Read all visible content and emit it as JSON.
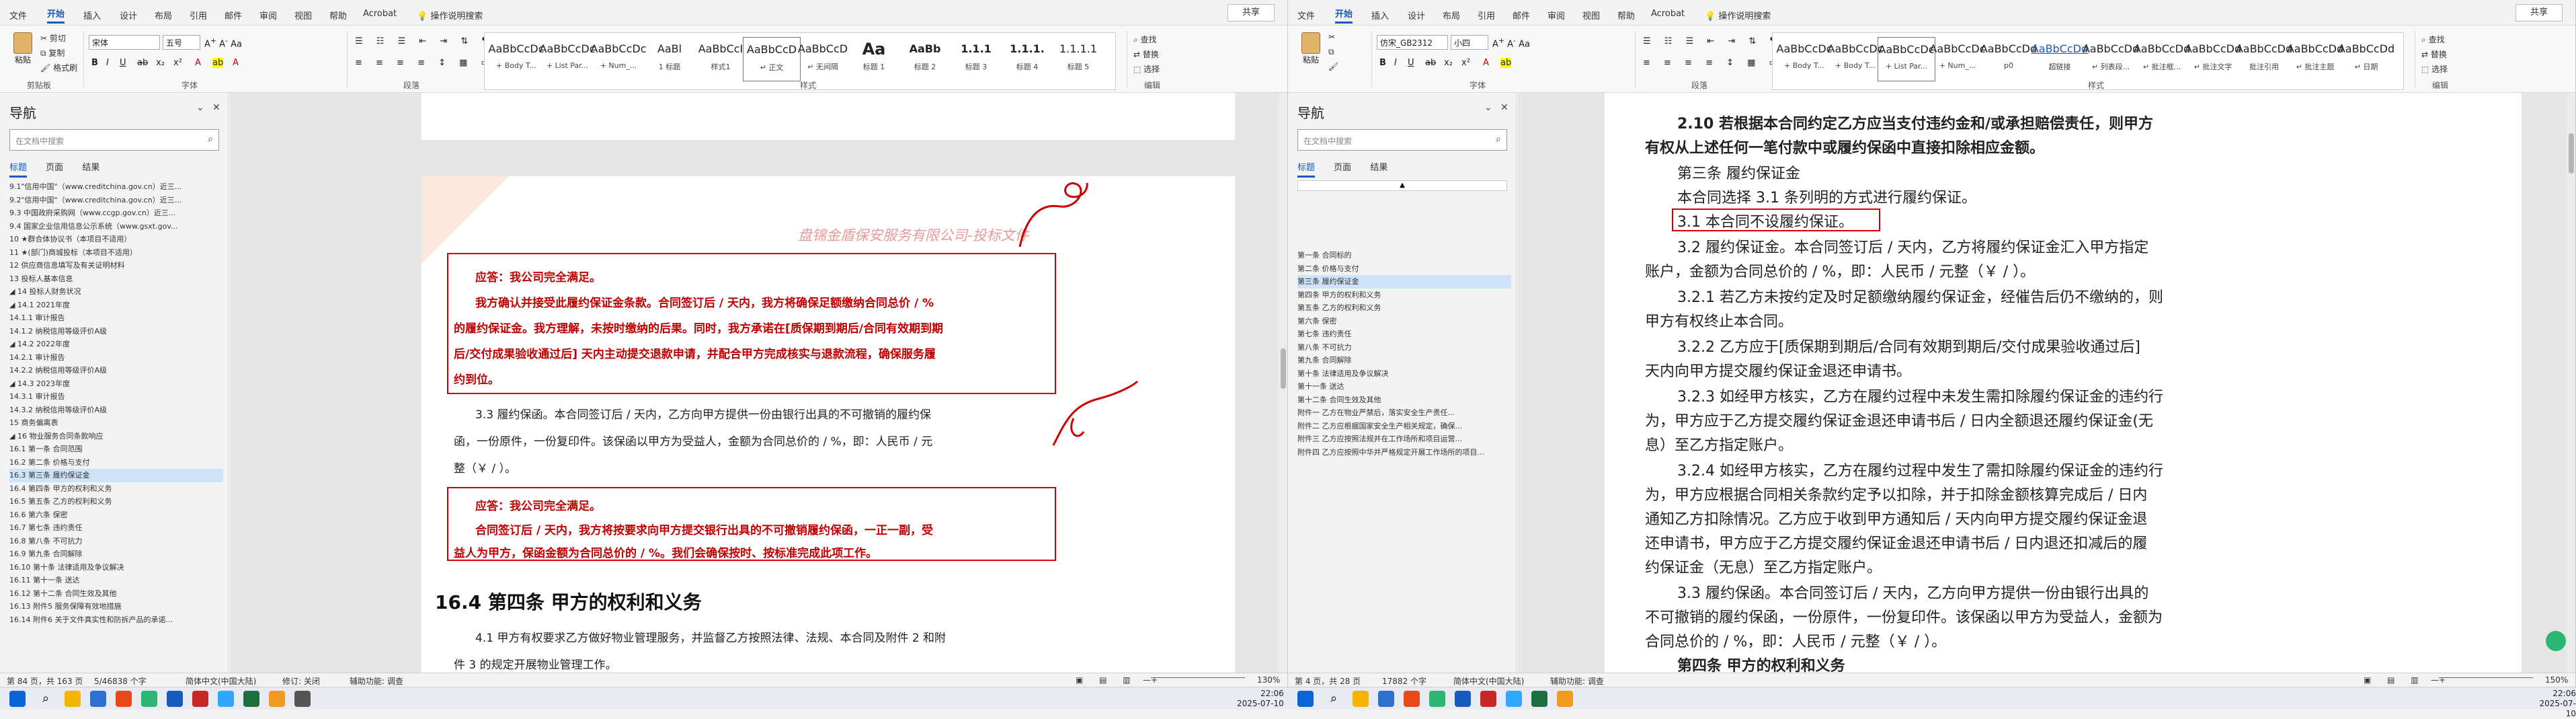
{
  "left_window": {
    "tabs": [
      "文件",
      "开始",
      "插入",
      "设计",
      "布局",
      "引用",
      "邮件",
      "审阅",
      "视图",
      "帮助",
      "Acrobat",
      "操作说明搜索"
    ],
    "share": "共享",
    "clipboard": {
      "paste": "粘贴",
      "cut": "剪切",
      "copy": "复制",
      "format_painter": "格式刷",
      "group": "剪贴板"
    },
    "font": {
      "name": "宋体",
      "size": "五号",
      "group": "字体"
    },
    "paragraph_group": "段落",
    "styles_group": "样式",
    "styles": [
      {
        "preview": "AaBbCcDc",
        "name": "+ Body T..."
      },
      {
        "preview": "AaBbCcDc",
        "name": "+ List Par..."
      },
      {
        "preview": "AaBbCcDc",
        "name": "+ Num_..."
      },
      {
        "preview": "AaBl",
        "name": "1 标题"
      },
      {
        "preview": "AaBbCcI",
        "name": "样式1"
      },
      {
        "preview": "AaBbCcD",
        "name": "↵ 正文"
      },
      {
        "preview": "AaBbCcD",
        "name": "↵ 无间隔"
      },
      {
        "preview": "Aa",
        "name": "标题 1"
      },
      {
        "preview": "AaBb",
        "name": "标题 2"
      },
      {
        "preview": "1.1.1",
        "name": "标题 3"
      },
      {
        "preview": "1.1.1.",
        "name": "标题 4"
      },
      {
        "preview": "1.1.1.1",
        "name": "标题 5"
      }
    ],
    "editing": {
      "find": "查找",
      "replace": "替换",
      "select": "选择",
      "group": "编辑"
    },
    "nav": {
      "title": "导航",
      "search_placeholder": "在文档中搜索",
      "tabs": [
        "标题",
        "页面",
        "结果"
      ],
      "items": [
        {
          "text": "9.1\"信用中国\"（www.creditchina.gov.cn）近三...",
          "sel": false
        },
        {
          "text": "9.2\"信用中国\"（www.creditchina.gov.cn）近三...",
          "sel": false
        },
        {
          "text": "9.3 中国政府采购网（www.ccgp.gov.cn）近三...",
          "sel": false
        },
        {
          "text": "9.4 国家企业信用信息公示系统（www.gsxt.gov...",
          "sel": false
        },
        {
          "text": "10 ★群合体协议书（本项目不适用）",
          "sel": false
        },
        {
          "text": "11 ★(部门)商城投标（本项目不适用）",
          "sel": false
        },
        {
          "text": "12 供应商信息填写及有关证明材料",
          "sel": false
        },
        {
          "text": "13 投标人基本信息",
          "sel": false
        },
        {
          "text": "◢ 14 投标人财务状况",
          "sel": false
        },
        {
          "text": "◢ 14.1 2021年度",
          "sel": false
        },
        {
          "text": "14.1.1 审计报告",
          "sel": false
        },
        {
          "text": "14.1.2 纳税信用等级评价A级",
          "sel": false
        },
        {
          "text": "◢ 14.2 2022年度",
          "sel": false
        },
        {
          "text": "14.2.1 审计报告",
          "sel": false
        },
        {
          "text": "14.2.2 纳税信用等级评价A级",
          "sel": false
        },
        {
          "text": "◢ 14.3 2023年度",
          "sel": false
        },
        {
          "text": "14.3.1 审计报告",
          "sel": false
        },
        {
          "text": "14.3.2 纳税信用等级评价A级",
          "sel": false
        },
        {
          "text": "15 商务偏离表",
          "sel": false
        },
        {
          "text": "◢ 16 物业服务合同条款响应",
          "sel": false
        },
        {
          "text": "16.1 第一条 合同范围",
          "sel": false
        },
        {
          "text": "16.2 第二条 价格与支付",
          "sel": false
        },
        {
          "text": "16.3 第三条 履约保证金",
          "sel": true
        },
        {
          "text": "16.4 第四条 甲方的权利和义务",
          "sel": false
        },
        {
          "text": "16.5 第五条 乙方的权利和义务",
          "sel": false
        },
        {
          "text": "16.6 第六条 保密",
          "sel": false
        },
        {
          "text": "16.7 第七条 违约责任",
          "sel": false
        },
        {
          "text": "16.8 第八条 不可抗力",
          "sel": false
        },
        {
          "text": "16.9 第九条 合同解除",
          "sel": false
        },
        {
          "text": "16.10 第十条 法律适用及争议解决",
          "sel": false
        },
        {
          "text": "16.11 第十一条 送达",
          "sel": false
        },
        {
          "text": "16.12 第十二条 合同生效及其他",
          "sel": false
        },
        {
          "text": "16.13 附件5 服务保障有效地措施",
          "sel": false
        },
        {
          "text": "16.14 附件6 关于文件真实性和防拆产品的承诺...",
          "sel": false
        }
      ]
    },
    "doc": {
      "watermark": "盘锦金盾保安服务有限公司-投标文件",
      "reply1_title": "应答：我公司完全满足。",
      "reply1_lines": [
        "我方确认并接受此履约保证金条款。合同签订后 / 天内，我方将确保足额缴纳合同总价 / %",
        "的履约保证金。我方理解，未按时缴纳的后果。同时，我方承诺在[质保期到期后/合同有效期到期",
        "后/交付成果验收通过后] 天内主动提交退款申请，并配合甲方完成核实与退款流程，确保服务履",
        "约到位。"
      ],
      "clause33_lines": [
        "3.3 履约保函。本合同签订后 / 天内，乙方向甲方提供一份由银行出具的不可撤销的履约保",
        "函，一份原件，一份复印件。该保函以甲方为受益人，金额为合同总价的 / %，即：人民币 / 元",
        "整（￥ / ）。"
      ],
      "reply2_title": "应答：我公司完全满足。",
      "reply2_lines": [
        "合同签订后 / 天内，我方将按要求向甲方提交银行出具的不可撤销履约保函，一正一副，受",
        "益人为甲方，保函金额为合同总价的 / %。我们会确保按时、按标准完成此项工作。"
      ],
      "heading_164": "16.4 第四条  甲方的权利和义务",
      "para41_lines": [
        "4.1 甲方有权要求乙方做好物业管理服务，并监督乙方按照法律、法规、本合同及附件 2 和附",
        "件 3 的规定开展物业管理工作。"
      ]
    },
    "status": {
      "page": "第 84 页，共 163 页",
      "words": "5/46838 个字",
      "lang": "简体中文(中国大陆)",
      "track": "修订: 关闭",
      "access": "辅助功能: 调查",
      "zoom": "130%"
    }
  },
  "right_window": {
    "tabs": [
      "文件",
      "开始",
      "插入",
      "设计",
      "布局",
      "引用",
      "邮件",
      "审阅",
      "视图",
      "帮助",
      "Acrobat",
      "操作说明搜索"
    ],
    "share": "共享",
    "font": {
      "name": "仿宋_GB2312",
      "size": "小四"
    },
    "styles": [
      {
        "preview": "AaBbCcDc",
        "name": "+ Body T..."
      },
      {
        "preview": "AaBbCcDc",
        "name": "+ Body T..."
      },
      {
        "preview": "AaBbCcDc",
        "name": "+ List Par..."
      },
      {
        "preview": "AaBbCcDc",
        "name": "+ Num_..."
      },
      {
        "preview": "AaBbCcDd",
        "name": "p0"
      },
      {
        "preview": "AaBbCcDd",
        "name": "超链接"
      },
      {
        "preview": "AaBbCcDd",
        "name": "↵ 列表段..."
      },
      {
        "preview": "AaBbCcDd",
        "name": "↵ 批注框..."
      },
      {
        "preview": "AaBbCcDd",
        "name": "↵ 批注文字"
      },
      {
        "preview": "AaBbCcDd",
        "name": "批注引用"
      },
      {
        "preview": "AaBbCcDd",
        "name": "↵ 批注主题"
      },
      {
        "preview": "AaBbCcDd",
        "name": "↵ 日期"
      }
    ],
    "nav": {
      "title": "导航",
      "search_placeholder": "在文档中搜索",
      "tabs": [
        "标题",
        "页面",
        "结果"
      ],
      "items": [
        {
          "text": "第一条 合同标的",
          "sel": false
        },
        {
          "text": "第二条 价格与支付",
          "sel": false
        },
        {
          "text": "第三条 履约保证金",
          "sel": true
        },
        {
          "text": "第四条 甲方的权利和义务",
          "sel": false
        },
        {
          "text": "第五条 乙方的权利和义务",
          "sel": false
        },
        {
          "text": "第六条 保密",
          "sel": false
        },
        {
          "text": "第七条 违约责任",
          "sel": false
        },
        {
          "text": "第八条 不可抗力",
          "sel": false
        },
        {
          "text": "第九条 合同解除",
          "sel": false
        },
        {
          "text": "第十条 法律适用及争议解决",
          "sel": false
        },
        {
          "text": "第十一条 送达",
          "sel": false
        },
        {
          "text": "第十二条 合同生效及其他",
          "sel": false
        },
        {
          "text": "附件一 乙方在物业严禁后，落实安全生产责任...",
          "sel": false
        },
        {
          "text": "附件二 乙方应根据国家安全生产相关规定，确保...",
          "sel": false
        },
        {
          "text": "附件三 乙方应按照法规并在工作场所和项目运营...",
          "sel": false
        },
        {
          "text": "附件四 乙方应按照中华并严格规定开展工作场所的项目...",
          "sel": false
        }
      ]
    },
    "doc": {
      "p210a": "2.10 若根据本合同约定乙方应当支付违约金和/或承担赔偿责任，则甲方",
      "p210b": "有权从上述任何一笔付款中或履约保函中直接扣除相应金额。",
      "art3": "第三条 履约保证金",
      "p_choose": "本合同选择   3.1   条列明的方式进行履约保证。",
      "p31": "3.1 本合同不设履约保证。",
      "p32a": "3.2 履约保证金。本合同签订后 / 天内，乙方将履约保证金汇入甲方指定",
      "p32b": "账户，金额为合同总价的 / %，即：人民币 / 元整（￥ / ）。",
      "p321a": "3.2.1 若乙方未按约定及时足额缴纳履约保证金，经催告后仍不缴纳的，则",
      "p321b": "甲方有权终止本合同。",
      "p322a": "3.2.2 乙方应于[质保期到期后/合同有效期到期后/交付成果验收通过后]",
      "p322b": "天内向甲方提交履约保证金退还申请书。",
      "p323a": "3.2.3 如经甲方核实，乙方在履约过程中未发生需扣除履约保证金的违约行",
      "p323b": "为，甲方应于乙方提交履约保证金退还申请书后 / 日内全额退还履约保证金(无",
      "p323c": "息）至乙方指定账户。",
      "p324a": "3.2.4 如经甲方核实，乙方在履约过程中发生了需扣除履约保证金的违约行",
      "p324b": "为，甲方应根据合同相关条款约定予以扣除，并于扣除金额核算完成后 / 日内",
      "p324c": "通知乙方扣除情况。乙方应于收到甲方通知后 / 天内向甲方提交履约保证金退",
      "p324d": "还申请书，甲方应于乙方提交履约保证金退还申请书后 / 日内退还扣减后的履",
      "p324e": "约保证金（无息）至乙方指定账户。",
      "p33a": "3.3 履约保函。本合同签订后 / 天内，乙方向甲方提供一份由银行出具的",
      "p33b": "不可撤销的履约保函，一份原件，一份复印件。该保函以甲方为受益人，金额为",
      "p33c": "合同总价的 / %，即：人民币 / 元整（￥ / ）。",
      "art4": "第四条 甲方的权利和义务"
    },
    "status": {
      "page": "第 4 页，共 28 页",
      "words": "17882 个字",
      "lang": "简体中文(中国大陆)",
      "access": "辅助功能: 调查",
      "zoom": "150%"
    }
  },
  "taskbar": {
    "time": "22:06",
    "date": "2025-07-10"
  }
}
